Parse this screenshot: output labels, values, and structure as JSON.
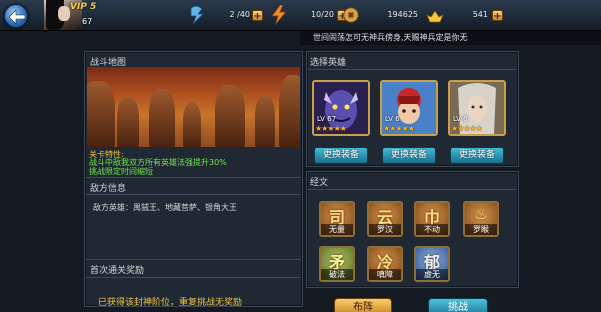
{
  "player": {
    "vip": "VIP 5",
    "level": "67"
  },
  "resources": {
    "stamina": {
      "icon": "stamina-icon",
      "value": "2 /40"
    },
    "energy": {
      "icon": "energy-icon",
      "value": "10/20"
    },
    "coins": {
      "icon": "coin-icon",
      "value": "194625"
    },
    "gold": {
      "icon": "gold-ingot-icon",
      "value": "541"
    }
  },
  "marquee": "世间闹荡怎可无神兵傍身,天赐神兵定是你无",
  "battle_map": {
    "title": "战斗地图",
    "traits_title": "关卡特性:",
    "traits": [
      "战斗中敌我双方所有英雄法强提升30%",
      "挑战限定时间缩短"
    ]
  },
  "enemy_info": {
    "title": "敌方信息",
    "text": "敌方英雄：禺狨王、地藏菩萨、银角大王"
  },
  "first_reward": {
    "title": "首次通关奖励",
    "text": "已获得该封神阶位，重复挑战无奖励"
  },
  "select_heroes": {
    "title": "选择英雄",
    "heroes": [
      {
        "level": "LV 67",
        "stars": "★★★★★",
        "button": "更换装备"
      },
      {
        "level": "LV 6",
        "stars": "★★★★★",
        "button": "更换装备"
      },
      {
        "level": "LV 6",
        "stars": "★★★★★",
        "button": "更换装备"
      }
    ]
  },
  "scriptures": {
    "title": "经文",
    "items": [
      {
        "glyph": "司",
        "name": "无量"
      },
      {
        "glyph": "云",
        "name": "罗汉"
      },
      {
        "glyph": "巾",
        "name": "不动"
      },
      {
        "glyph": "♨",
        "name": "罗睺"
      },
      {
        "glyph": "矛",
        "name": "破法"
      },
      {
        "glyph": "冷",
        "name": "嗔障"
      },
      {
        "glyph": "郁",
        "name": "虚无"
      }
    ]
  },
  "buttons": {
    "deploy": "布阵",
    "challenge": "挑战"
  },
  "colors": {
    "accent_gold": "#f0c23a",
    "trait_green": "#6fe84a",
    "button_blue": "#44bcd6",
    "button_gold": "#f7cf6a"
  }
}
